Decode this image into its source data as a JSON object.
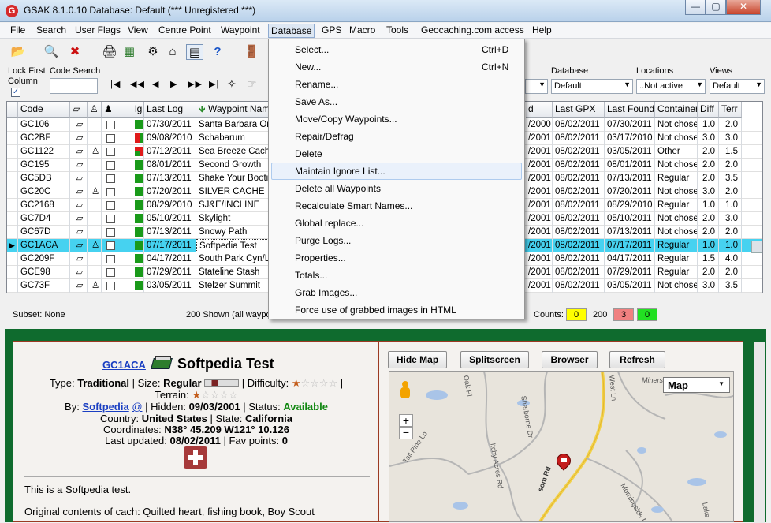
{
  "window": {
    "title": "GSAK 8.1.0.10   Database: Default   (*** Unregistered ***)",
    "app_icon": "G",
    "minimize": "—",
    "maximize": "▢",
    "close": "✕"
  },
  "menu": [
    "File",
    "Search",
    "User Flags",
    "View",
    "Centre Point",
    "Waypoint",
    "Database",
    "GPS",
    "Macro",
    "Tools",
    "Geocaching.com access",
    "Help"
  ],
  "controls": {
    "lock_first_column": "Lock First Column",
    "code_search": "Code Search",
    "database_label": "Database",
    "database_value": "Default",
    "locations_label": "Locations",
    "locations_value": "..Not active",
    "views_label": "Views",
    "views_value": "Default",
    "filter_value": "Default"
  },
  "grid": {
    "headers": {
      "code": "Code",
      "lg": "lg",
      "last_log": "Last Log",
      "waypoint_name": "Waypoint Name",
      "d": "d",
      "last_gpx": "Last GPX",
      "last_found": "Last Found",
      "container": "Container",
      "diff": "Diff",
      "terr": "Terr"
    },
    "rows": [
      {
        "code": "GC106",
        "bug": false,
        "log": "07/30/2011",
        "name": "Santa Barbara One",
        "placed": "/2000",
        "gpx": "08/02/2011",
        "found": "07/30/2011",
        "container": "Not chose",
        "diff": "1.0",
        "terr": "2.0",
        "c": [
          "g",
          "g",
          "g",
          "g"
        ]
      },
      {
        "code": "GC2BF",
        "bug": false,
        "log": "09/08/2010",
        "name": "Schabarum",
        "placed": "/2001",
        "gpx": "08/02/2011",
        "found": "03/17/2010",
        "container": "Not chose",
        "diff": "3.0",
        "terr": "3.0",
        "c": [
          "r",
          "g",
          "r",
          "g"
        ]
      },
      {
        "code": "GC1122",
        "bug": true,
        "log": "07/12/2011",
        "name": "Sea Breeze Cache",
        "placed": "/2001",
        "gpx": "08/02/2011",
        "found": "03/05/2011",
        "container": "Other",
        "diff": "2.0",
        "terr": "1.5",
        "c": [
          "r",
          "r",
          "g",
          "r"
        ]
      },
      {
        "code": "GC195",
        "bug": false,
        "log": "08/01/2011",
        "name": "Second Growth",
        "placed": "/2001",
        "gpx": "08/02/2011",
        "found": "08/01/2011",
        "container": "Not chose",
        "diff": "2.0",
        "terr": "2.0",
        "c": [
          "g",
          "g",
          "g",
          "g"
        ]
      },
      {
        "code": "GC5DB",
        "bug": false,
        "log": "07/13/2011",
        "name": "Shake Your Bootie",
        "placed": "/2001",
        "gpx": "08/02/2011",
        "found": "07/13/2011",
        "container": "Regular",
        "diff": "2.0",
        "terr": "3.5",
        "c": [
          "g",
          "g",
          "g",
          "g"
        ]
      },
      {
        "code": "GC20C",
        "bug": true,
        "log": "07/20/2011",
        "name": "SILVER CACHE",
        "placed": "/2001",
        "gpx": "08/02/2011",
        "found": "07/20/2011",
        "container": "Not chose",
        "diff": "3.0",
        "terr": "2.0",
        "c": [
          "g",
          "g",
          "g",
          "g"
        ]
      },
      {
        "code": "GC2168",
        "bug": false,
        "log": "08/29/2010",
        "name": "SJ&E/INCLINE",
        "placed": "/2001",
        "gpx": "08/02/2011",
        "found": "08/29/2010",
        "container": "Regular",
        "diff": "1.0",
        "terr": "1.0",
        "c": [
          "g",
          "g",
          "g",
          "g"
        ]
      },
      {
        "code": "GC7D4",
        "bug": false,
        "log": "05/10/2011",
        "name": "Skylight",
        "placed": "/2001",
        "gpx": "08/02/2011",
        "found": "05/10/2011",
        "container": "Not chose",
        "diff": "2.0",
        "terr": "3.0",
        "c": [
          "g",
          "g",
          "g",
          "g"
        ]
      },
      {
        "code": "GC67D",
        "bug": false,
        "log": "07/13/2011",
        "name": "Snowy Path",
        "placed": "/2001",
        "gpx": "08/02/2011",
        "found": "07/13/2011",
        "container": "Not chose",
        "diff": "2.0",
        "terr": "2.0",
        "c": [
          "g",
          "g",
          "g",
          "g"
        ]
      },
      {
        "code": "GC1ACA",
        "bug": true,
        "log": "07/17/2011",
        "name": "Softpedia Test",
        "placed": "/2001",
        "gpx": "08/02/2011",
        "found": "07/17/2011",
        "container": "Regular",
        "diff": "1.0",
        "terr": "1.0",
        "c": [
          "g",
          "g",
          "g",
          "g"
        ],
        "selected": true
      },
      {
        "code": "GC209F",
        "bug": false,
        "log": "04/17/2011",
        "name": "South Park Cyn/La",
        "placed": "/2001",
        "gpx": "08/02/2011",
        "found": "04/17/2011",
        "container": "Regular",
        "diff": "1.5",
        "terr": "4.0",
        "c": [
          "g",
          "g",
          "g",
          "g"
        ]
      },
      {
        "code": "GCE98",
        "bug": false,
        "log": "07/29/2011",
        "name": "Stateline Stash",
        "placed": "/2001",
        "gpx": "08/02/2011",
        "found": "07/29/2011",
        "container": "Regular",
        "diff": "2.0",
        "terr": "2.0",
        "c": [
          "g",
          "g",
          "g",
          "g"
        ]
      },
      {
        "code": "GC73F",
        "bug": true,
        "log": "03/05/2011",
        "name": "Stelzer Summit",
        "placed": "/2001",
        "gpx": "08/02/2011",
        "found": "03/05/2011",
        "container": "Not chose",
        "diff": "3.0",
        "terr": "3.5",
        "c": [
          "g",
          "g",
          "g",
          "g"
        ]
      }
    ]
  },
  "status": {
    "subset": "Subset: None",
    "shown": "200 Shown (all waypoints)",
    "counts_label": "Counts:",
    "count_yellow": "0",
    "count_total": "200",
    "count_red": "3",
    "count_green": "0"
  },
  "dropdown": [
    {
      "label": "Select...",
      "shortcut": "Ctrl+D"
    },
    {
      "label": "New...",
      "shortcut": "Ctrl+N"
    },
    {
      "label": "Rename...",
      "shortcut": ""
    },
    {
      "label": "Save As...",
      "shortcut": ""
    },
    {
      "label": "Move/Copy Waypoints...",
      "shortcut": ""
    },
    {
      "label": "Repair/Defrag",
      "shortcut": ""
    },
    {
      "label": "Delete",
      "shortcut": ""
    },
    {
      "label": "Maintain Ignore List...",
      "shortcut": ""
    },
    {
      "label": "Delete all Waypoints",
      "shortcut": ""
    },
    {
      "label": "Recalculate Smart Names...",
      "shortcut": ""
    },
    {
      "label": "Global replace...",
      "shortcut": ""
    },
    {
      "label": "Purge Logs...",
      "shortcut": ""
    },
    {
      "label": "Properties...",
      "shortcut": ""
    },
    {
      "label": "Totals...",
      "shortcut": ""
    },
    {
      "label": "Grab Images...",
      "shortcut": ""
    },
    {
      "label": "Force use of grabbed images in HTML",
      "shortcut": ""
    }
  ],
  "detail": {
    "code_link": "GC1ACA",
    "title": "Softpedia Test",
    "type_label": "Type:",
    "type_value": "Traditional",
    "size_label": "Size:",
    "size_value": "Regular",
    "difficulty_label": "Difficulty:",
    "terrain_label": "Terrain:",
    "by_label": "By:",
    "by_value": "Softpedia",
    "by_at": "@",
    "hidden_label": "Hidden:",
    "hidden_value": "09/03/2001",
    "status_label": "Status:",
    "status_value": "Available",
    "country_label": "Country:",
    "country_value": "United States",
    "state_label": "State:",
    "state_value": "California",
    "coords_label": "Coordinates:",
    "coords_value": "N38° 45.209 W121° 10.126",
    "updated_label": "Last updated:",
    "updated_value": "08/02/2011",
    "fav_label": "Fav points:",
    "fav_value": "0",
    "short_desc": "This is a Softpedia test.",
    "long_desc": "Original contents of cach: Quilted heart, fishing book, Boy Scout",
    "difficulty_stars": 1,
    "terrain_stars": 1
  },
  "mapbar": {
    "hide_map": "Hide Map",
    "splitscreen": "Splitscreen",
    "browser": "Browser",
    "refresh": "Refresh",
    "map_type": "Map"
  },
  "map_labels": {
    "oak": "Oak Pl",
    "sherborne": "Sherborne Dr",
    "acres": "Itchy Acres Rd",
    "pine": "Tall Pine Ln",
    "morning": "Morningside Dr",
    "west": "West Ln",
    "mines": "Miners",
    "som": "som Rd",
    "lake": "Lake"
  }
}
